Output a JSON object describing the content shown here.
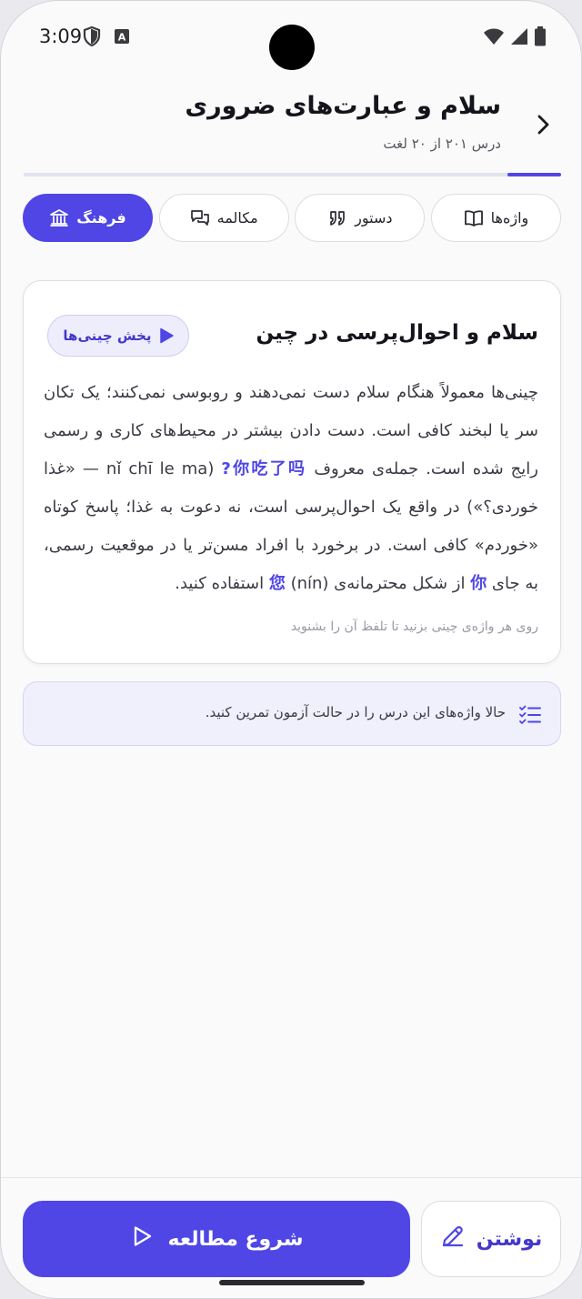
{
  "status_bar": {
    "time": "3:09",
    "icons": [
      "shield-icon",
      "a-box-icon",
      "wifi-icon",
      "signal-icon",
      "battery-icon"
    ]
  },
  "header": {
    "title": "سلام و عبارت‌های ضروری",
    "subtitle": "درس ۲۰۱ از ۲۰ لغت",
    "back_icon": "chevron-right-icon"
  },
  "progress": {
    "fraction": 0.1
  },
  "tabs": [
    {
      "label": "واژه‌ها",
      "icon": "book-icon",
      "active": false
    },
    {
      "label": "دستور",
      "icon": "quote-icon",
      "active": false
    },
    {
      "label": "مکالمه",
      "icon": "chat-icon",
      "active": false
    },
    {
      "label": "فرهنگ",
      "icon": "bank-icon",
      "active": true
    }
  ],
  "card": {
    "title": "سلام و احوال‌پرسی در چین",
    "play_button": "پخش چینی‌ها",
    "body": {
      "p1": "چینی‌ها معمولاً هنگام سلام دست نمی‌دهند و روبوسی نمی‌کنند؛ یک تکان سر یا لبخند کافی است. دست دادن بیشتر در محیط‌های کاری و رسمی رایج شده است. جمله‌ی معروف ",
      "zh1": "你吃了吗?",
      "p2": " (nǐ chī le ma — «غذا خوردی؟») در واقع یک احوال‌پرسی است، نه دعوت به غذا؛ پاسخ کوتاه «خوردم» کافی است. در برخورد با افراد مسن‌تر یا در موقعیت رسمی، به جای ",
      "zh2": "你",
      "p3": " از شکل محترمانه‌ی ",
      "zh3": "您",
      "p4": " (nín) استفاده کنید."
    },
    "hint": "روی هر واژه‌ی چینی بزنید تا تلفظ آن را بشنوید"
  },
  "tip": {
    "text": "حالا واژه‌های این درس را در حالت آزمون تمرین کنید."
  },
  "bottom": {
    "start_label": "شروع مطالعه",
    "writing_label": "نوشتن"
  },
  "colors": {
    "accent": "#4f46e5",
    "accent_soft": "#eeedfb",
    "background": "#fafafa"
  }
}
